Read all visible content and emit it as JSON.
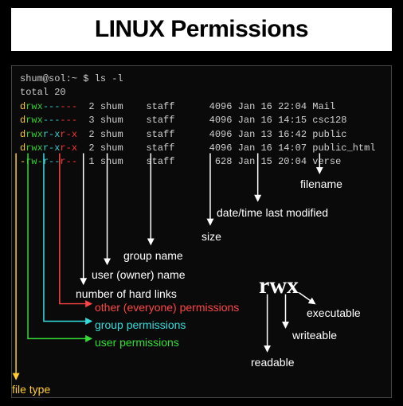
{
  "title": "LINUX Permissions",
  "prompt": "shum@sol:~ $ ls -l",
  "total_line": "total 20",
  "rows": [
    {
      "type": "d",
      "user": "rwx",
      "group": "---",
      "other": "---",
      "links": "2",
      "owner": "shum",
      "grp": "staff",
      "size": "4096",
      "date": "Jan 16 22:04",
      "name": "Mail"
    },
    {
      "type": "d",
      "user": "rwx",
      "group": "---",
      "other": "---",
      "links": "3",
      "owner": "shum",
      "grp": "staff",
      "size": "4096",
      "date": "Jan 16 14:15",
      "name": "csc128"
    },
    {
      "type": "d",
      "user": "rwx",
      "group": "r-x",
      "other": "r-x",
      "links": "2",
      "owner": "shum",
      "grp": "staff",
      "size": "4096",
      "date": "Jan 13 16:42",
      "name": "public"
    },
    {
      "type": "d",
      "user": "rwx",
      "group": "r-x",
      "other": "r-x",
      "links": "2",
      "owner": "shum",
      "grp": "staff",
      "size": "4096",
      "date": "Jan 16 14:07",
      "name": "public_html"
    },
    {
      "type": "-",
      "user": "rw-",
      "group": "r--",
      "other": "r--",
      "links": "1",
      "owner": "shum",
      "grp": "staff",
      "size": "628",
      "date": "Jan 15 20:04",
      "name": "verse"
    }
  ],
  "labels": {
    "filename": "filename",
    "datetime": "date/time last modified",
    "size": "size",
    "groupname": "group name",
    "username": "user (owner) name",
    "hardlinks": "number of hard links",
    "other_perm": "other (everyone) permissions",
    "group_perm": "group permissions",
    "user_perm": "user permissions",
    "filetype": "file type",
    "rwx": "rwx",
    "executable": "executable",
    "writeable": "writeable",
    "readable": "readable"
  }
}
